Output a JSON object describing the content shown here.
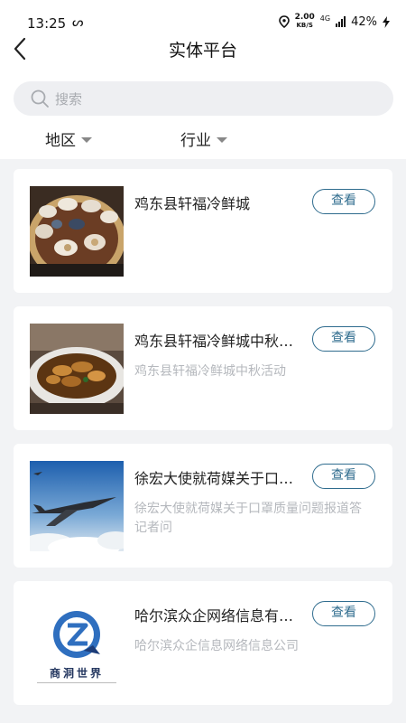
{
  "status_bar": {
    "time": "13:25",
    "sync_glyph": "ᔕ",
    "net_speed_value": "2.00",
    "net_speed_unit": "KB/S",
    "network": "4G",
    "battery": "42%"
  },
  "nav": {
    "title": "实体平台"
  },
  "search": {
    "placeholder": "搜索"
  },
  "filters": {
    "region": "地区",
    "industry": "行业"
  },
  "items": [
    {
      "title": "鸡东县轩福冷鲜城",
      "description": "",
      "button": "查看"
    },
    {
      "title": "鸡东县轩福冷鲜城中秋…",
      "description": "鸡东县轩福冷鲜城中秋活动",
      "button": "查看"
    },
    {
      "title": "徐宏大使就荷媒关于口…",
      "description": "徐宏大使就荷媒关于口罩质量问题报道答记者问",
      "button": "查看"
    },
    {
      "title": "哈尔滨众企网络信息有…",
      "description": "哈尔滨众企信息网络信息公司",
      "button": "查看",
      "logo_text": "商洞世界"
    }
  ],
  "colors": {
    "accent": "#2f6c8e",
    "background": "#f2f3f5",
    "muted_text": "#b5b8bd"
  }
}
